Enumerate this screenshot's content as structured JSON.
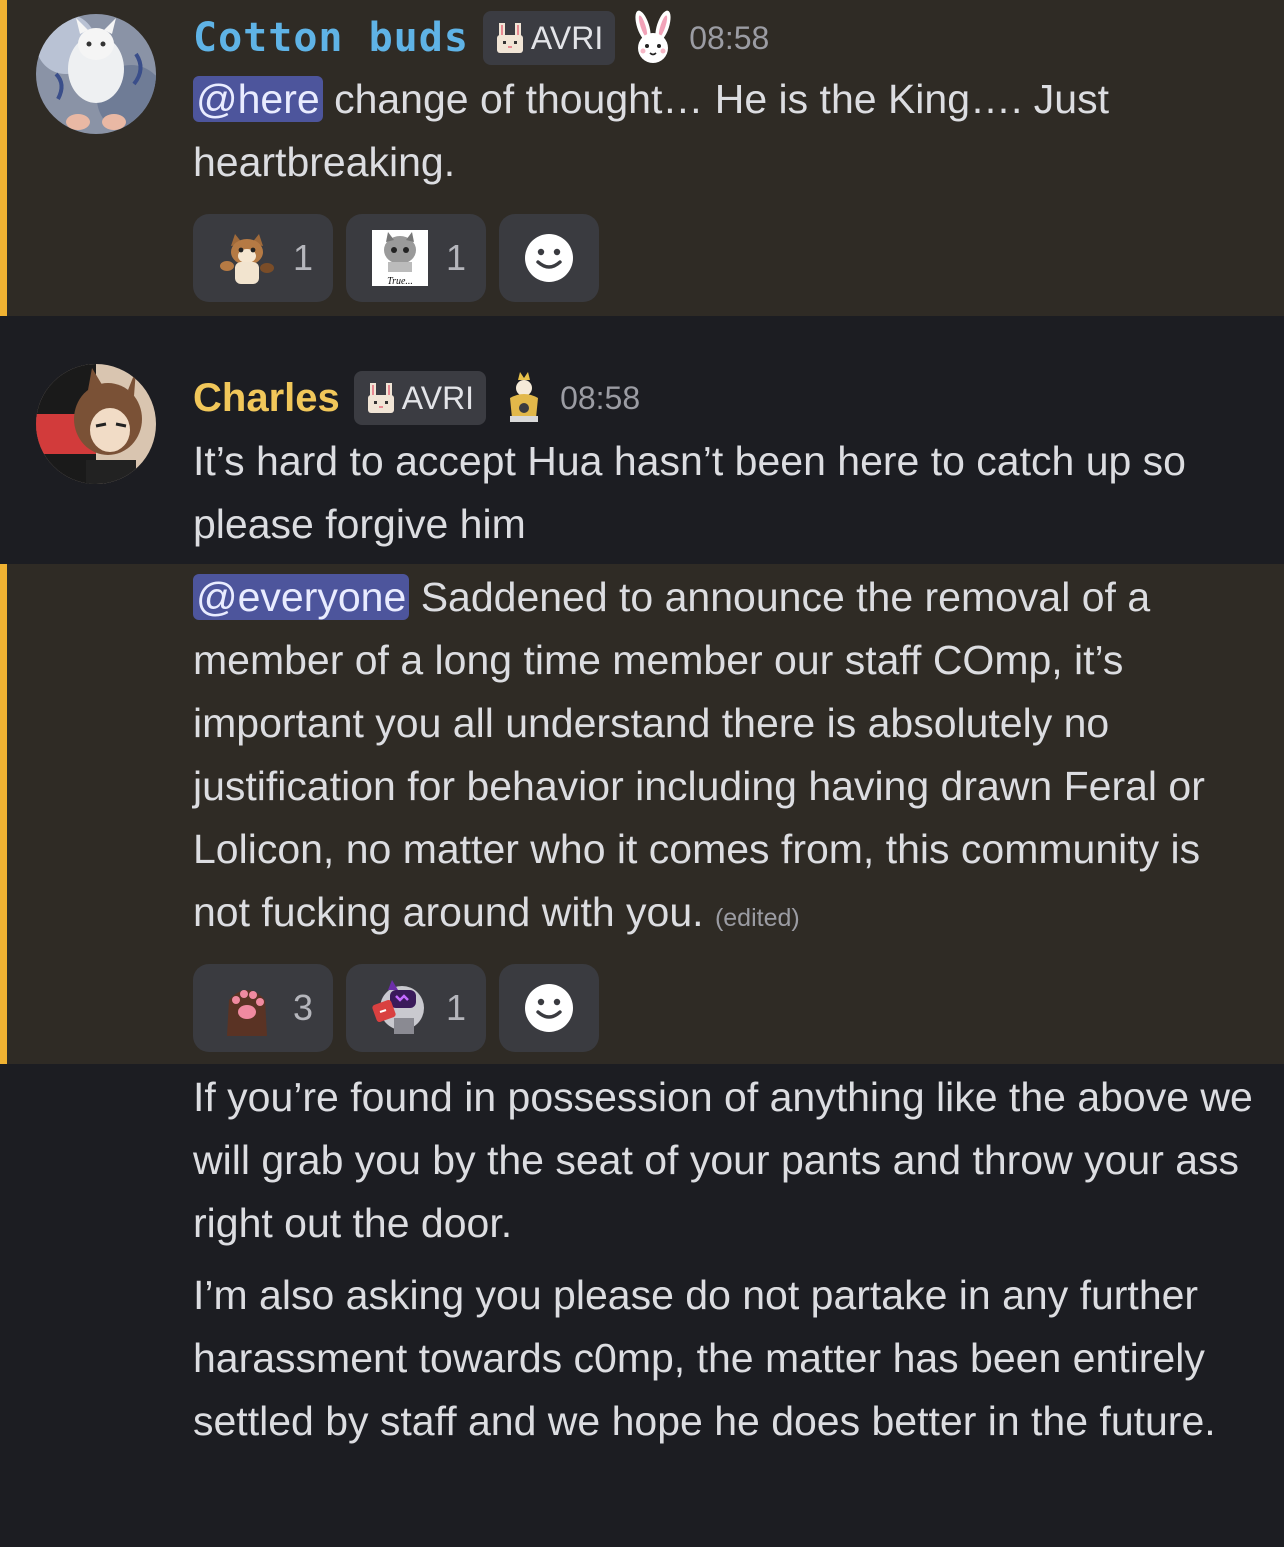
{
  "messages": [
    {
      "username": "Cotton buds",
      "tag": "AVRI",
      "timestamp": "08:58",
      "mention": "@here",
      "text": " change of thought… He is the King…. Just heartbreaking.",
      "reactions": [
        {
          "emoji": "cat-emoji",
          "count": "1"
        },
        {
          "emoji": "true-sticker-emoji",
          "caption": "True...",
          "count": "1"
        }
      ]
    },
    {
      "username": "Charles",
      "tag": "AVRI",
      "timestamp": "08:58",
      "text": "It’s hard to accept Hua hasn’t been here to catch up so please forgive him"
    },
    {
      "mention": "@everyone",
      "text": " Saddened to announce the removal of a member of a long time member our staff COmp, it’s important you all understand there is absolutely no justification for behavior including having drawn Feral or Lolicon, no matter who it comes from, this community is not fucking around with you.",
      "edited": "(edited)",
      "reactions": [
        {
          "emoji": "paw-emoji",
          "count": "3"
        },
        {
          "emoji": "robot-cat-emoji",
          "count": "1"
        }
      ]
    },
    {
      "text": "If you’re found in possession of anything like the above we will grab you by the seat of your pants and throw your ass right out the door."
    },
    {
      "text": "I’m also asking you please do not partake in any further harassment towards c0mp, the matter has been entirely settled by staff and we hope he does better in the future."
    }
  ],
  "colors": {
    "background": "#1c1d22",
    "highlight": "#2f2b25",
    "highlight_bar": "#f0b232",
    "mention_bg": "#4d559c",
    "cotton_name": "#5fb3e6",
    "charles_name": "#f1c75a"
  }
}
